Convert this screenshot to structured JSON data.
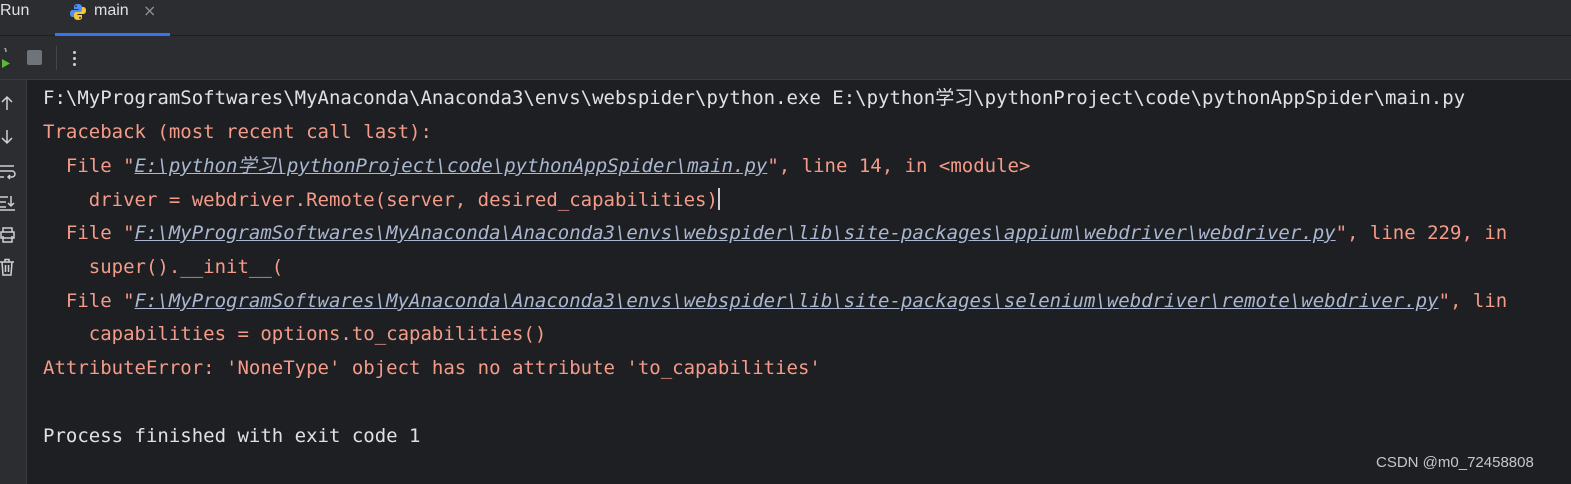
{
  "header": {
    "title": "Run",
    "tab": {
      "label": "main",
      "close": "×",
      "icon": "python-icon"
    }
  },
  "toolbar": {
    "items": [
      "rerun-icon",
      "stop-icon",
      "more-options-icon"
    ]
  },
  "gutter": {
    "icons": [
      "arrow-up-icon",
      "arrow-down-icon",
      "soft-wrap-icon",
      "scroll-to-end-icon",
      "print-icon",
      "trash-icon"
    ]
  },
  "console": {
    "lines": [
      {
        "type": "command",
        "text": "F:\\MyProgramSoftwares\\MyAnaconda\\Anaconda3\\envs\\webspider\\python.exe E:\\python学习\\pythonProject\\code\\pythonAppSpider\\main.py"
      },
      {
        "type": "error",
        "text": "Traceback (most recent call last):"
      },
      {
        "type": "frame",
        "prefix": "  File \"",
        "link": "E:\\python学习\\pythonProject\\code\\pythonAppSpider\\main.py",
        "suffix": "\", line 14, in <module>"
      },
      {
        "type": "code",
        "text": "    driver = webdriver.Remote(server, desired_capabilities)"
      },
      {
        "type": "frame",
        "prefix": "  File \"",
        "link": "F:\\MyProgramSoftwares\\MyAnaconda\\Anaconda3\\envs\\webspider\\lib\\site-packages\\appium\\webdriver\\webdriver.py",
        "suffix": "\", line 229, in"
      },
      {
        "type": "code",
        "text": "    super().__init__("
      },
      {
        "type": "frame",
        "prefix": "  File \"",
        "link": "F:\\MyProgramSoftwares\\MyAnaconda\\Anaconda3\\envs\\webspider\\lib\\site-packages\\selenium\\webdriver\\remote\\webdriver.py",
        "suffix": "\", lin"
      },
      {
        "type": "code",
        "text": "    capabilities = options.to_capabilities()"
      },
      {
        "type": "error",
        "text": "AttributeError: 'NoneType' object has no attribute 'to_capabilities'"
      },
      {
        "type": "blank",
        "text": ""
      },
      {
        "type": "command",
        "text": "Process finished with exit code 1"
      }
    ]
  },
  "watermark": "CSDN @m0_72458808",
  "colors": {
    "background": "#1e1f22",
    "panel": "#2b2d30",
    "accent": "#3574f0",
    "text": "#dfe1e5",
    "error": "#f49b89",
    "link": "#a9b7d0"
  }
}
